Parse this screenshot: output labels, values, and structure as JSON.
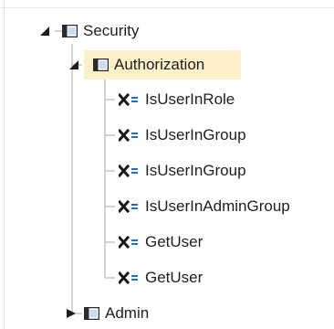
{
  "tree": {
    "security": {
      "label": "Security",
      "expanded": true
    },
    "authorization": {
      "label": "Authorization",
      "expanded": true,
      "selected": true,
      "methods": [
        {
          "label": "IsUserInRole",
          "icon": "method-icon"
        },
        {
          "label": "IsUserInGroup",
          "icon": "method-icon"
        },
        {
          "label": "IsUserInGroup",
          "icon": "method-icon"
        },
        {
          "label": "IsUserInAdminGroup",
          "icon": "method-icon"
        },
        {
          "label": "GetUser",
          "icon": "method-icon"
        },
        {
          "label": "GetUser",
          "icon": "method-icon"
        }
      ]
    },
    "admin": {
      "label": "Admin",
      "expanded": false
    }
  },
  "colors": {
    "selection_bg": "#fdf0c8",
    "icon_dark": "#2b2b2b",
    "icon_fill": "#c8ddf2",
    "method_eq": "#1f6fd1",
    "tree_line": "#a8a8a8"
  }
}
